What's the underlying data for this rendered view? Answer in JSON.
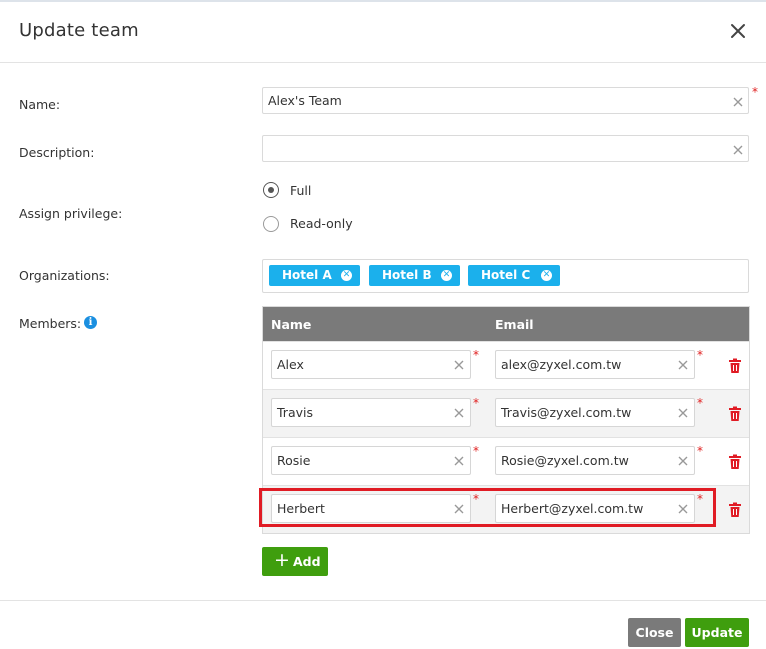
{
  "dialog": {
    "title": "Update team"
  },
  "form": {
    "name": {
      "label": "Name:",
      "value": "Alex's Team",
      "required_mark": "*"
    },
    "description": {
      "label": "Description:",
      "value": ""
    },
    "privilege": {
      "label": "Assign privilege:",
      "options": [
        "Full",
        "Read-only"
      ],
      "selected": "Full"
    },
    "organizations": {
      "label": "Organizations:",
      "tags": [
        "Hotel A",
        "Hotel B",
        "Hotel C"
      ]
    },
    "members": {
      "label": "Members:",
      "columns": [
        "Name",
        "Email"
      ],
      "rows": [
        {
          "name": "Alex",
          "email": "alex@zyxel.com.tw"
        },
        {
          "name": "Travis",
          "email": "Travis@zyxel.com.tw"
        },
        {
          "name": "Rosie",
          "email": "Rosie@zyxel.com.tw"
        },
        {
          "name": "Herbert",
          "email": "Herbert@zyxel.com.tw"
        }
      ],
      "add_label": "Add"
    }
  },
  "footer": {
    "close_label": "Close",
    "update_label": "Update"
  },
  "colors": {
    "accent_green": "#3f9e0e",
    "tag_blue": "#1bb0ec",
    "required_red": "#e02020",
    "highlight_red": "#e01b24",
    "header_gray": "#7a7a7a"
  }
}
